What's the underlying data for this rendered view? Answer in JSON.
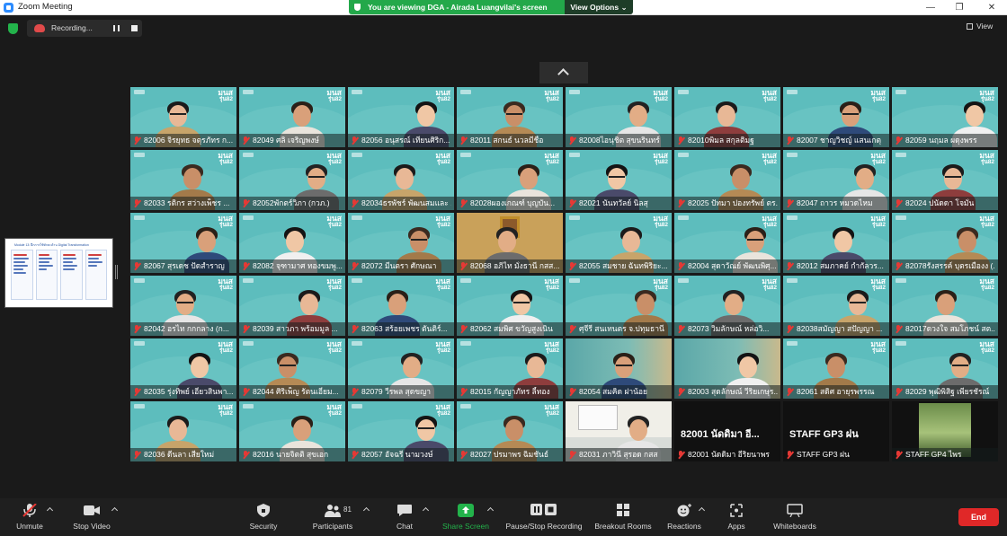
{
  "window": {
    "title": "Zoom Meeting"
  },
  "share_banner": {
    "message": "You are viewing DGA - Airada Luangvilai's screen",
    "view_options": "View Options"
  },
  "recording": {
    "label": "Recording..."
  },
  "view_button": {
    "label": "View"
  },
  "shared_content": {
    "header": "Module 13: ฝึกการใช้ทักษะด้าน Digital Transformation"
  },
  "gallery": {
    "brand": "มนส",
    "brand_sub": "รุ่น82",
    "tiles": [
      {
        "name": "82006 จิรยุทธ จตุรภัทร ก...",
        "muted": true
      },
      {
        "name": "82049 ศลิ เจริญพงษ์",
        "muted": true
      },
      {
        "name": "82056 อนุสรณ์ เทียนศิริก...",
        "muted": true
      },
      {
        "name": "82011 สกนธ์ นวลมีชื่อ",
        "muted": true
      },
      {
        "name": "82008ไอนุชิต สุขนรินทร์",
        "muted": true
      },
      {
        "name": "82010พิมล สกุลติมฐ",
        "muted": true
      },
      {
        "name": "82007 ชาญวิชญ์ แสนเกตุ",
        "muted": true
      },
      {
        "name": "82059 นฤมล ผดุงพรร",
        "muted": true
      },
      {
        "name": "82033 รติกร สว่างเพ็ชร ...",
        "muted": true
      },
      {
        "name": "82052พักตร์วิภา (กวภ.)",
        "muted": true
      },
      {
        "name": "82034ธรพัชร์ พัฒนสมและ ...",
        "muted": true
      },
      {
        "name": "82028ผองเกณฑ์ บุญบัน...",
        "muted": true
      },
      {
        "name": "82021 นันทวัลย์ นิลสุ",
        "muted": true
      },
      {
        "name": "82025 ปัทมา ปองทรัพย์ ตร...",
        "muted": true
      },
      {
        "name": "82047 ถาวร หมวดไหม",
        "muted": true
      },
      {
        "name": "82024 ปนัดดา โจมั่น",
        "muted": true
      },
      {
        "name": "82067 สุรเดช ปัดสำราญ",
        "muted": true
      },
      {
        "name": "82082 จุฑามาศ ทองขมพู...",
        "muted": true
      },
      {
        "name": "82072 มีนตรา ศักษณา",
        "muted": true
      },
      {
        "name": "82068 อภิไท มั่งธานี กสส...",
        "muted": true
      },
      {
        "name": "82055 สมชาย ฉันทพิริยะ...",
        "muted": true
      },
      {
        "name": "82004 สุดาวัณย์ พัฒนพิศุ...",
        "muted": true
      },
      {
        "name": "82012 สมภาคย์ กำกัลวร...",
        "muted": true
      },
      {
        "name": "82078รังสรรค์ บุตรเมืองง (...",
        "muted": true
      },
      {
        "name": "82042 อรไท กกกลาง (ก...",
        "muted": true
      },
      {
        "name": "82039 สาวภา พร้อมมูล ...",
        "muted": true
      },
      {
        "name": "82063 สร้อยเพชร ตันติร์...",
        "muted": true
      },
      {
        "name": "82062 สมพิศ ขวัญสูงเนิน",
        "muted": true
      },
      {
        "name": "ศุจีรี สนเทนตร จ.ปทุมธานี",
        "muted": true
      },
      {
        "name": "82073 วิมลักษณ์ หล่อวิ...",
        "muted": true
      },
      {
        "name": "82038สมัญญา สปัญญา ...",
        "muted": true
      },
      {
        "name": "82017ดวงใจ สมโภชน์ สต...",
        "muted": true
      },
      {
        "name": "82035 รุ่งทิพย์ เอี่ยวสินพา...",
        "muted": true
      },
      {
        "name": "82044 ศิริเพ็ญ รัตนเอี่ยม...",
        "muted": true
      },
      {
        "name": "82079 วีรพล สุดขญา",
        "muted": true
      },
      {
        "name": "82015 กัญญาภัทร ลี้ทอง",
        "muted": true
      },
      {
        "name": "82054 สมคิด ฝาน้อย",
        "muted": true
      },
      {
        "name": "82003 สุดลักษณ์ วีริยเกษุร...",
        "muted": true
      },
      {
        "name": "82061 สดิศ อายุรพรรณ",
        "muted": true
      },
      {
        "name": "82029 พุฒิพิสิฐ เพียรชัรณ์",
        "muted": true
      },
      {
        "name": "82036 ดีนลา เสียใหม่",
        "muted": true
      },
      {
        "name": "82016 นายจิตติ สุขเอก",
        "muted": true
      },
      {
        "name": "82057 อัจฉรี นามวงษ์",
        "muted": true
      },
      {
        "name": "82027 ปรมาพร ฉิมชันธ์",
        "muted": true
      },
      {
        "name": "82031 ภาวินี สุรอด กสส",
        "muted": true
      },
      {
        "name": "82001 นัดดิมา อีริยนาพร",
        "muted": true,
        "big_name": "82001 นัดดิมา อี..."
      },
      {
        "name": "STAFF GP3 ฝน",
        "muted": true,
        "big_name": "STAFF GP3 ฝน"
      },
      {
        "name": "STAFF GP4 ไพร",
        "muted": true
      }
    ]
  },
  "toolbar": {
    "unmute": "Unmute",
    "stop_video": "Stop Video",
    "security": "Security",
    "participants": "Participants",
    "participants_count": "81",
    "chat": "Chat",
    "share_screen": "Share Screen",
    "pause_recording": "Pause/Stop Recording",
    "breakout_rooms": "Breakout Rooms",
    "reactions": "Reactions",
    "apps": "Apps",
    "whiteboards": "Whiteboards",
    "end": "End"
  },
  "colors": {
    "tile_teal": "#5dbdbd",
    "banner_green": "#23a84a",
    "share_green": "#23b34b",
    "end_red": "#e02828",
    "mute_red": "#e53935"
  }
}
